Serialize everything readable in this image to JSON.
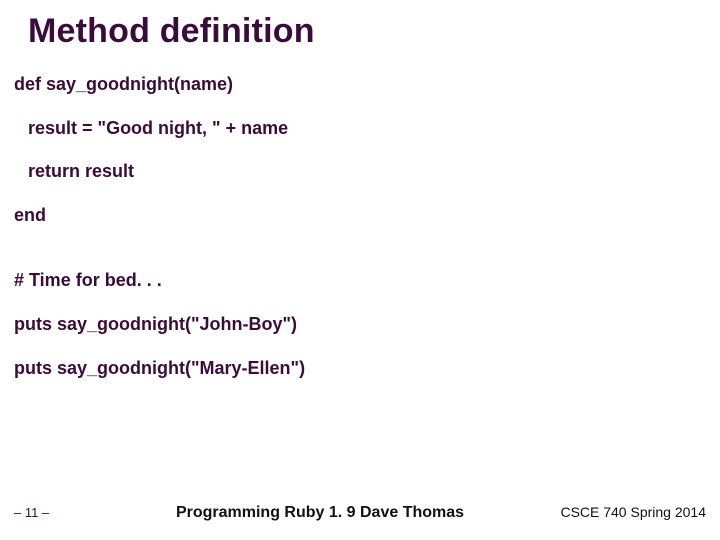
{
  "title": "Method definition",
  "code": {
    "l1": "def say_goodnight(name)",
    "l2": "result = \"Good night, \" + name",
    "l3": "return result",
    "l4": "end",
    "l5": "# Time for bed. . .",
    "l6": "puts say_goodnight(\"John-Boy\")",
    "l7": "puts say_goodnight(\"Mary-Ellen\")"
  },
  "footer": {
    "page": "– 11 –",
    "center": "Programming Ruby 1. 9 Dave Thomas",
    "right": "CSCE 740 Spring 2014"
  }
}
